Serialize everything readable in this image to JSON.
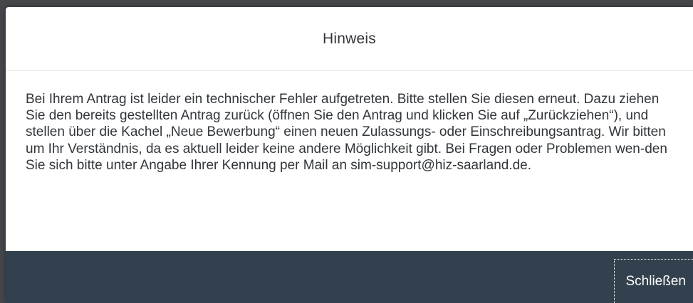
{
  "dialog": {
    "title": "Hinweis",
    "message": "Bei Ihrem Antrag ist leider ein technischer Fehler aufgetreten. Bitte stellen Sie diesen erneut. Dazu ziehen Sie den bereits gestellten Antrag zurück (öffnen Sie den Antrag und klicken Sie auf „Zurückziehen“), und stellen über die Kachel „Neue Bewerbung“ einen neuen Zulassungs- oder Einschreibungsantrag. Wir bitten um Ihr Verständnis, da es aktuell leider keine andere Möglichkeit gibt. Bei Fragen oder Problemen wen-den Sie sich bitte unter Angabe Ihrer Kennung per Mail an sim-support@hiz-saarland.de.",
    "close_label": "Schließen"
  },
  "colors": {
    "backdrop": "#45484b",
    "footer": "#33414e",
    "text": "#32363a"
  }
}
